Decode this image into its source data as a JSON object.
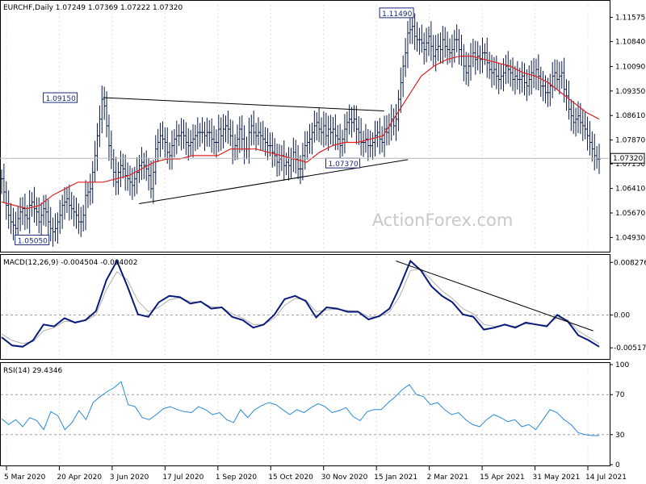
{
  "chart_data": [
    {
      "panel": "price",
      "type": "ohlc",
      "header": "EURCHF,Daily  1.07249 1.07369 1.07222 1.07320",
      "ylim": [
        1.0455,
        1.1195
      ],
      "y_ticks": [
        "1.11575",
        "1.10840",
        "1.10090",
        "1.09350",
        "1.08610",
        "1.07870",
        "1.07150",
        "1.06410",
        "1.05670",
        "1.04930"
      ],
      "current_price_label": "1.07320",
      "current_price": 1.0732,
      "close_series": [
        1.067,
        1.063,
        1.059,
        1.056,
        1.054,
        1.053,
        1.052,
        1.055,
        1.057,
        1.058,
        1.056,
        1.055,
        1.059,
        1.06,
        1.058,
        1.057,
        1.054,
        1.056,
        1.058,
        1.057,
        1.054,
        1.052,
        1.051,
        1.052,
        1.054,
        1.056,
        1.059,
        1.06,
        1.061,
        1.059,
        1.058,
        1.057,
        1.056,
        1.054,
        1.054,
        1.056,
        1.062,
        1.063,
        1.064,
        1.069,
        1.074,
        1.08,
        1.085,
        1.091,
        1.089,
        1.083,
        1.077,
        1.073,
        1.069,
        1.066,
        1.069,
        1.071,
        1.07,
        1.068,
        1.067,
        1.066,
        1.065,
        1.067,
        1.069,
        1.071,
        1.072,
        1.071,
        1.07,
        1.068,
        1.064,
        1.069,
        1.076,
        1.078,
        1.08,
        1.079,
        1.078,
        1.075,
        1.074,
        1.077,
        1.079,
        1.08,
        1.08,
        1.081,
        1.08,
        1.078,
        1.077,
        1.078,
        1.079,
        1.08,
        1.081,
        1.081,
        1.081,
        1.08,
        1.081,
        1.081,
        1.079,
        1.078,
        1.078,
        1.082,
        1.08,
        1.082,
        1.083,
        1.082,
        1.08,
        1.076,
        1.077,
        1.079,
        1.082,
        1.079,
        1.076,
        1.076,
        1.081,
        1.083,
        1.081,
        1.08,
        1.081,
        1.08,
        1.079,
        1.078,
        1.077,
        1.077,
        1.075,
        1.074,
        1.072,
        1.073,
        1.074,
        1.071,
        1.072,
        1.071,
        1.073,
        1.075,
        1.073,
        1.07,
        1.07,
        1.074,
        1.077,
        1.078,
        1.079,
        1.081,
        1.083,
        1.084,
        1.082,
        1.081,
        1.083,
        1.08,
        1.082,
        1.081,
        1.082,
        1.08,
        1.079,
        1.077,
        1.079,
        1.082,
        1.084,
        1.085,
        1.084,
        1.085,
        1.082,
        1.081,
        1.078,
        1.078,
        1.079,
        1.077,
        1.077,
        1.078,
        1.08,
        1.081,
        1.079,
        1.078,
        1.082,
        1.081,
        1.083,
        1.085,
        1.083,
        1.085,
        1.091,
        1.096,
        1.101,
        1.105,
        1.111,
        1.112,
        1.113,
        1.11,
        1.109,
        1.109,
        1.108,
        1.106,
        1.108,
        1.11,
        1.107,
        1.104,
        1.106,
        1.107,
        1.106,
        1.109,
        1.107,
        1.106,
        1.105,
        1.106,
        1.109,
        1.109,
        1.106,
        1.104,
        1.101,
        1.099,
        1.101,
        1.104,
        1.105,
        1.103,
        1.104,
        1.103,
        1.105,
        1.105,
        1.102,
        1.1,
        1.099,
        1.1,
        1.098,
        1.097,
        1.098,
        1.099,
        1.101,
        1.1,
        1.099,
        1.097,
        1.098,
        1.097,
        1.097,
        1.098,
        1.096,
        1.095,
        1.097,
        1.099,
        1.098,
        1.1,
        1.098,
        1.095,
        1.095,
        1.093,
        1.093,
        1.095,
        1.098,
        1.099,
        1.097,
        1.098,
        1.099,
        1.094,
        1.092,
        1.088,
        1.086,
        1.084,
        1.085,
        1.086,
        1.084,
        1.083,
        1.082,
        1.08,
        1.078,
        1.076,
        1.074,
        1.073,
        1.073
      ],
      "moving_average": [
        1.06,
        1.059,
        1.058,
        1.059,
        1.062,
        1.064,
        1.066,
        1.066,
        1.066,
        1.067,
        1.068,
        1.07,
        1.072,
        1.073,
        1.073,
        1.074,
        1.074,
        1.074,
        1.076,
        1.076,
        1.076,
        1.075,
        1.074,
        1.073,
        1.072,
        1.075,
        1.077,
        1.078,
        1.078,
        1.079,
        1.08,
        1.086,
        1.092,
        1.098,
        1.101,
        1.103,
        1.104,
        1.104,
        1.103,
        1.102,
        1.101,
        1.099,
        1.098,
        1.096,
        1.093,
        1.09,
        1.087,
        1.085
      ],
      "annotations": [
        {
          "text": "1.11490",
          "value": 1.1149,
          "position": "above"
        },
        {
          "text": "1.09150",
          "value": 1.0915,
          "position": "left"
        },
        {
          "text": "1.07370",
          "value": 1.0737,
          "position": "below"
        },
        {
          "text": "1.05050",
          "value": 1.0505,
          "position": "below"
        }
      ],
      "trendlines": [
        {
          "name": "upper",
          "from": {
            "x_frac": 0.17,
            "y": 1.0915
          },
          "to": {
            "x_frac": 0.64,
            "y": 1.0875
          }
        },
        {
          "name": "lower",
          "from": {
            "x_frac": 0.23,
            "y": 1.0595
          },
          "to": {
            "x_frac": 0.68,
            "y": 1.0728
          }
        }
      ],
      "watermark": "ActionForex.com",
      "colors": {
        "bars": "#0a1a4a",
        "ma": "#e02020",
        "grid": "#c0c0c0"
      }
    },
    {
      "panel": "macd",
      "type": "line",
      "header": "MACD(12,26,9) -0.004504 -0.004002",
      "ylim": [
        -0.0068,
        0.0092
      ],
      "y_ticks": [
        "0.008276",
        "0.00",
        "-0.005174"
      ],
      "series": [
        {
          "values": [
            -0.0035,
            -0.0048,
            -0.005,
            -0.004,
            -0.0015,
            -0.0018,
            -0.0005,
            -0.0012,
            -0.0008,
            0.0006,
            0.0055,
            0.0085,
            0.0045,
            0.0001,
            -0.0003,
            0.002,
            0.003,
            0.0028,
            0.0018,
            0.0021,
            0.001,
            0.0012,
            -0.0003,
            -0.0008,
            -0.002,
            -0.0015,
            0.0,
            0.0025,
            0.003,
            0.0022,
            -0.0004,
            0.0012,
            0.001,
            0.0005,
            0.0005,
            -0.0007,
            -0.0002,
            0.001,
            0.0045,
            0.0085,
            0.007,
            0.0045,
            0.003,
            0.002,
            0.0001,
            -0.0003,
            -0.0023,
            -0.002,
            -0.0015,
            -0.002,
            -0.0012,
            -0.0015,
            -0.0018,
            0.0,
            -0.001,
            -0.0032,
            -0.004,
            -0.005
          ],
          "color": "#0a1a7a"
        },
        {
          "values": [
            -0.003,
            -0.004,
            -0.0045,
            -0.0042,
            -0.0025,
            -0.002,
            -0.001,
            -0.0011,
            -0.0009,
            0.0,
            0.004,
            0.0068,
            0.0055,
            0.0022,
            0.0005,
            0.0012,
            0.0024,
            0.0027,
            0.0021,
            0.002,
            0.0013,
            0.0012,
            0.0002,
            -0.0005,
            -0.0015,
            -0.0015,
            -0.0005,
            0.0015,
            0.0026,
            0.0024,
            0.0005,
            0.0008,
            0.0009,
            0.0007,
            0.0006,
            -0.0003,
            -0.0003,
            0.0005,
            0.003,
            0.007,
            0.0072,
            0.0055,
            0.0038,
            0.0026,
            0.001,
            0.0002,
            -0.0015,
            -0.0018,
            -0.0016,
            -0.0018,
            -0.0014,
            -0.0015,
            -0.0016,
            -0.0004,
            -0.0008,
            -0.0025,
            -0.0035,
            -0.0045
          ],
          "color": "#b0b0b0"
        }
      ],
      "trendlines": [
        {
          "name": "downtrend",
          "from": {
            "x_frac": 0.66,
            "y": 0.0085
          },
          "to": {
            "x_frac": 0.99,
            "y": -0.0025
          }
        }
      ],
      "colors": {
        "grid": "#c0c0c0"
      }
    },
    {
      "panel": "rsi",
      "type": "line",
      "header": "RSI(14) 29.4346",
      "ylim": [
        0,
        100
      ],
      "y_ticks": [
        "100",
        "70",
        "30",
        "0"
      ],
      "series": [
        {
          "values": [
            46,
            40,
            45,
            38,
            47,
            44,
            35,
            53,
            49,
            35,
            42,
            54,
            45,
            62,
            68,
            73,
            77,
            83,
            60,
            58,
            47,
            45,
            50,
            56,
            58,
            55,
            53,
            52,
            58,
            55,
            50,
            52,
            45,
            42,
            55,
            47,
            55,
            59,
            62,
            60,
            55,
            50,
            55,
            52,
            57,
            61,
            58,
            52,
            54,
            57,
            48,
            44,
            53,
            55,
            55,
            62,
            68,
            75,
            80,
            70,
            68,
            60,
            62,
            55,
            50,
            52,
            45,
            40,
            38,
            45,
            50,
            47,
            43,
            45,
            38,
            40,
            35,
            45,
            55,
            52,
            45,
            40,
            32,
            30,
            29,
            29
          ],
          "color": "#2a8ad6"
        }
      ],
      "colors": {
        "grid": "#c0c0c0"
      }
    }
  ],
  "x_axis": {
    "tick_labels": [
      "5 Mar 2020",
      "20 Apr 2020",
      "3 Jun 2020",
      "17 Jul 2020",
      "1 Sep 2020",
      "15 Oct 2020",
      "30 Nov 2020",
      "15 Jan 2021",
      "2 Mar 2021",
      "15 Apr 2021",
      "31 May 2021",
      "14 Jul 2021"
    ],
    "range": [
      "5 Mar 2020",
      "30 Jul 2021"
    ]
  }
}
